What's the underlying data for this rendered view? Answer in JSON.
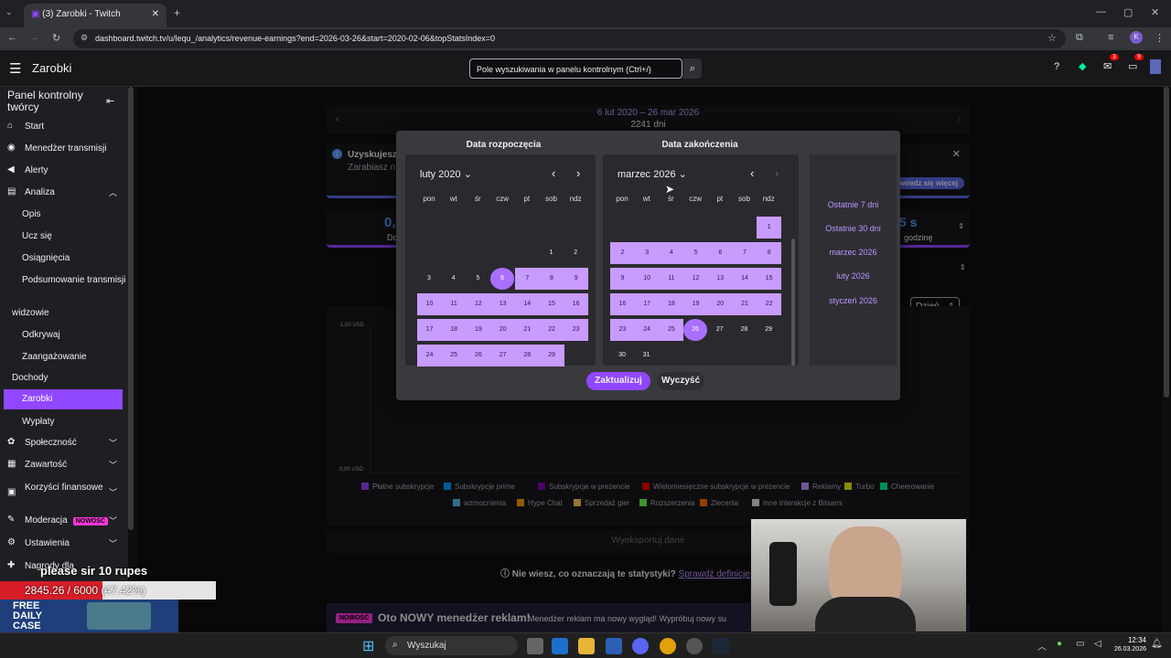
{
  "browser": {
    "tab_title": "(3) Zarobki - Twitch",
    "url": "dashboard.twitch.tv/u/lequ_/analytics/revenue-earnings?end=2026-03-26&start=2020-02-06&topStatsIndex=0",
    "profile_letter": "K"
  },
  "header": {
    "title": "Zarobki",
    "search_placeholder": "Pole wyszukiwania w panelu kontrolnym (Ctrl+/)",
    "notif_badge_1": "3",
    "notif_badge_2": "9"
  },
  "sidebar": {
    "title": "Panel kontrolny twórcy",
    "items": [
      {
        "label": "Start"
      },
      {
        "label": "Menedżer transmisji"
      },
      {
        "label": "Alerty"
      },
      {
        "label": "Analiza"
      },
      {
        "label": "Opis"
      },
      {
        "label": "Ucz się"
      },
      {
        "label": "Osiągnięcia"
      },
      {
        "label": "Podsumowanie transmisji"
      },
      {
        "label": "widzowie"
      },
      {
        "label": "Odkrywaj"
      },
      {
        "label": "Zaangażowanie"
      },
      {
        "label": "Dochody"
      },
      {
        "label": "Zarobki"
      },
      {
        "label": "Wypłaty"
      },
      {
        "label": "Społeczność"
      },
      {
        "label": "Zawartość"
      },
      {
        "label": "Korzyści finansowe"
      },
      {
        "label": "Moderacja"
      },
      {
        "label": "Ustawienia"
      },
      {
        "label": "Nagrody dla"
      }
    ],
    "new_badge": "NOWOŚĆ"
  },
  "date_range": {
    "range": "6 lut 2020 – 26 mar 2026",
    "days": "2241 dni"
  },
  "info_banner": {
    "title": "Uzyskujesz",
    "text": "Zarabiasz n",
    "learn_more": "dowiedz się więcej"
  },
  "stats": {
    "value1": "0,",
    "label1": "Do",
    "value2": "5 s",
    "label2": "godzinę"
  },
  "chart": {
    "y_top": "1,00 USD",
    "y_bottom": "0,00 USD",
    "interval": "Dzień",
    "export": "Wyeksportuj dane"
  },
  "chart_data": {
    "type": "area",
    "ylim": [
      0,
      1
    ],
    "series": [],
    "legend": [
      {
        "name": "Płatne subskrypcje",
        "color": "#9147ff"
      },
      {
        "name": "Subskrypcje prime",
        "color": "#00a3ff"
      },
      {
        "name": "Subskrypcje w prezencie",
        "color": "#8205b4"
      },
      {
        "name": "Wielomiesięczne subskrypcje w prezencie",
        "color": "#eb0400"
      },
      {
        "name": "Reklamy",
        "color": "#bf94ff"
      },
      {
        "name": "Turbo",
        "color": "#f0f000"
      },
      {
        "name": "Cheerowanie",
        "color": "#00f593"
      },
      {
        "name": "wzmocnienia",
        "color": "#57bee6"
      },
      {
        "name": "Hype Chat",
        "color": "#ff9900"
      },
      {
        "name": "Sprzedaż gier",
        "color": "#ffca5f"
      },
      {
        "name": "Rozszerzenia",
        "color": "#69ff47"
      },
      {
        "name": "Zlecenia",
        "color": "#ff6905"
      },
      {
        "name": "Inne interakcje z Bitsami",
        "color": "#dedede"
      }
    ]
  },
  "help": {
    "question": "Nie wiesz, co oznaczają te statystyki?",
    "link": "Sprawdź definicje p"
  },
  "promo": {
    "badge": "NOWOŚĆ",
    "title": "Oto NOWY menedżer reklam!",
    "text": "Menedżer reklam ma nowy wygląd! Wypróbuj nowy su"
  },
  "datepicker": {
    "start_label": "Data rozpoczęcia",
    "end_label": "Data zakończenia",
    "start_month": "luty 2020",
    "end_month": "marzec 2026",
    "weekdays": [
      "pon",
      "wt",
      "śr",
      "czw",
      "pt",
      "sob",
      "ndz"
    ],
    "presets": [
      "Ostatnie 7 dni",
      "Ostatnie 30 dni",
      "marzec 2026",
      "luty 2026",
      "styczeń 2026"
    ],
    "update": "Zaktualizuj",
    "clear": "Wyczyść"
  },
  "overlay": {
    "donation_text": "please sir 10 rupes",
    "progress_text": "2845.26 / 6000 (47.42%)",
    "progress_fraction": 0.4742,
    "promo_line1": "FREE",
    "promo_line2": "DAILY",
    "promo_line3": "CASE"
  },
  "taskbar": {
    "search": "Wyszukaj",
    "time": "12:34",
    "date": "26.03.2026"
  }
}
